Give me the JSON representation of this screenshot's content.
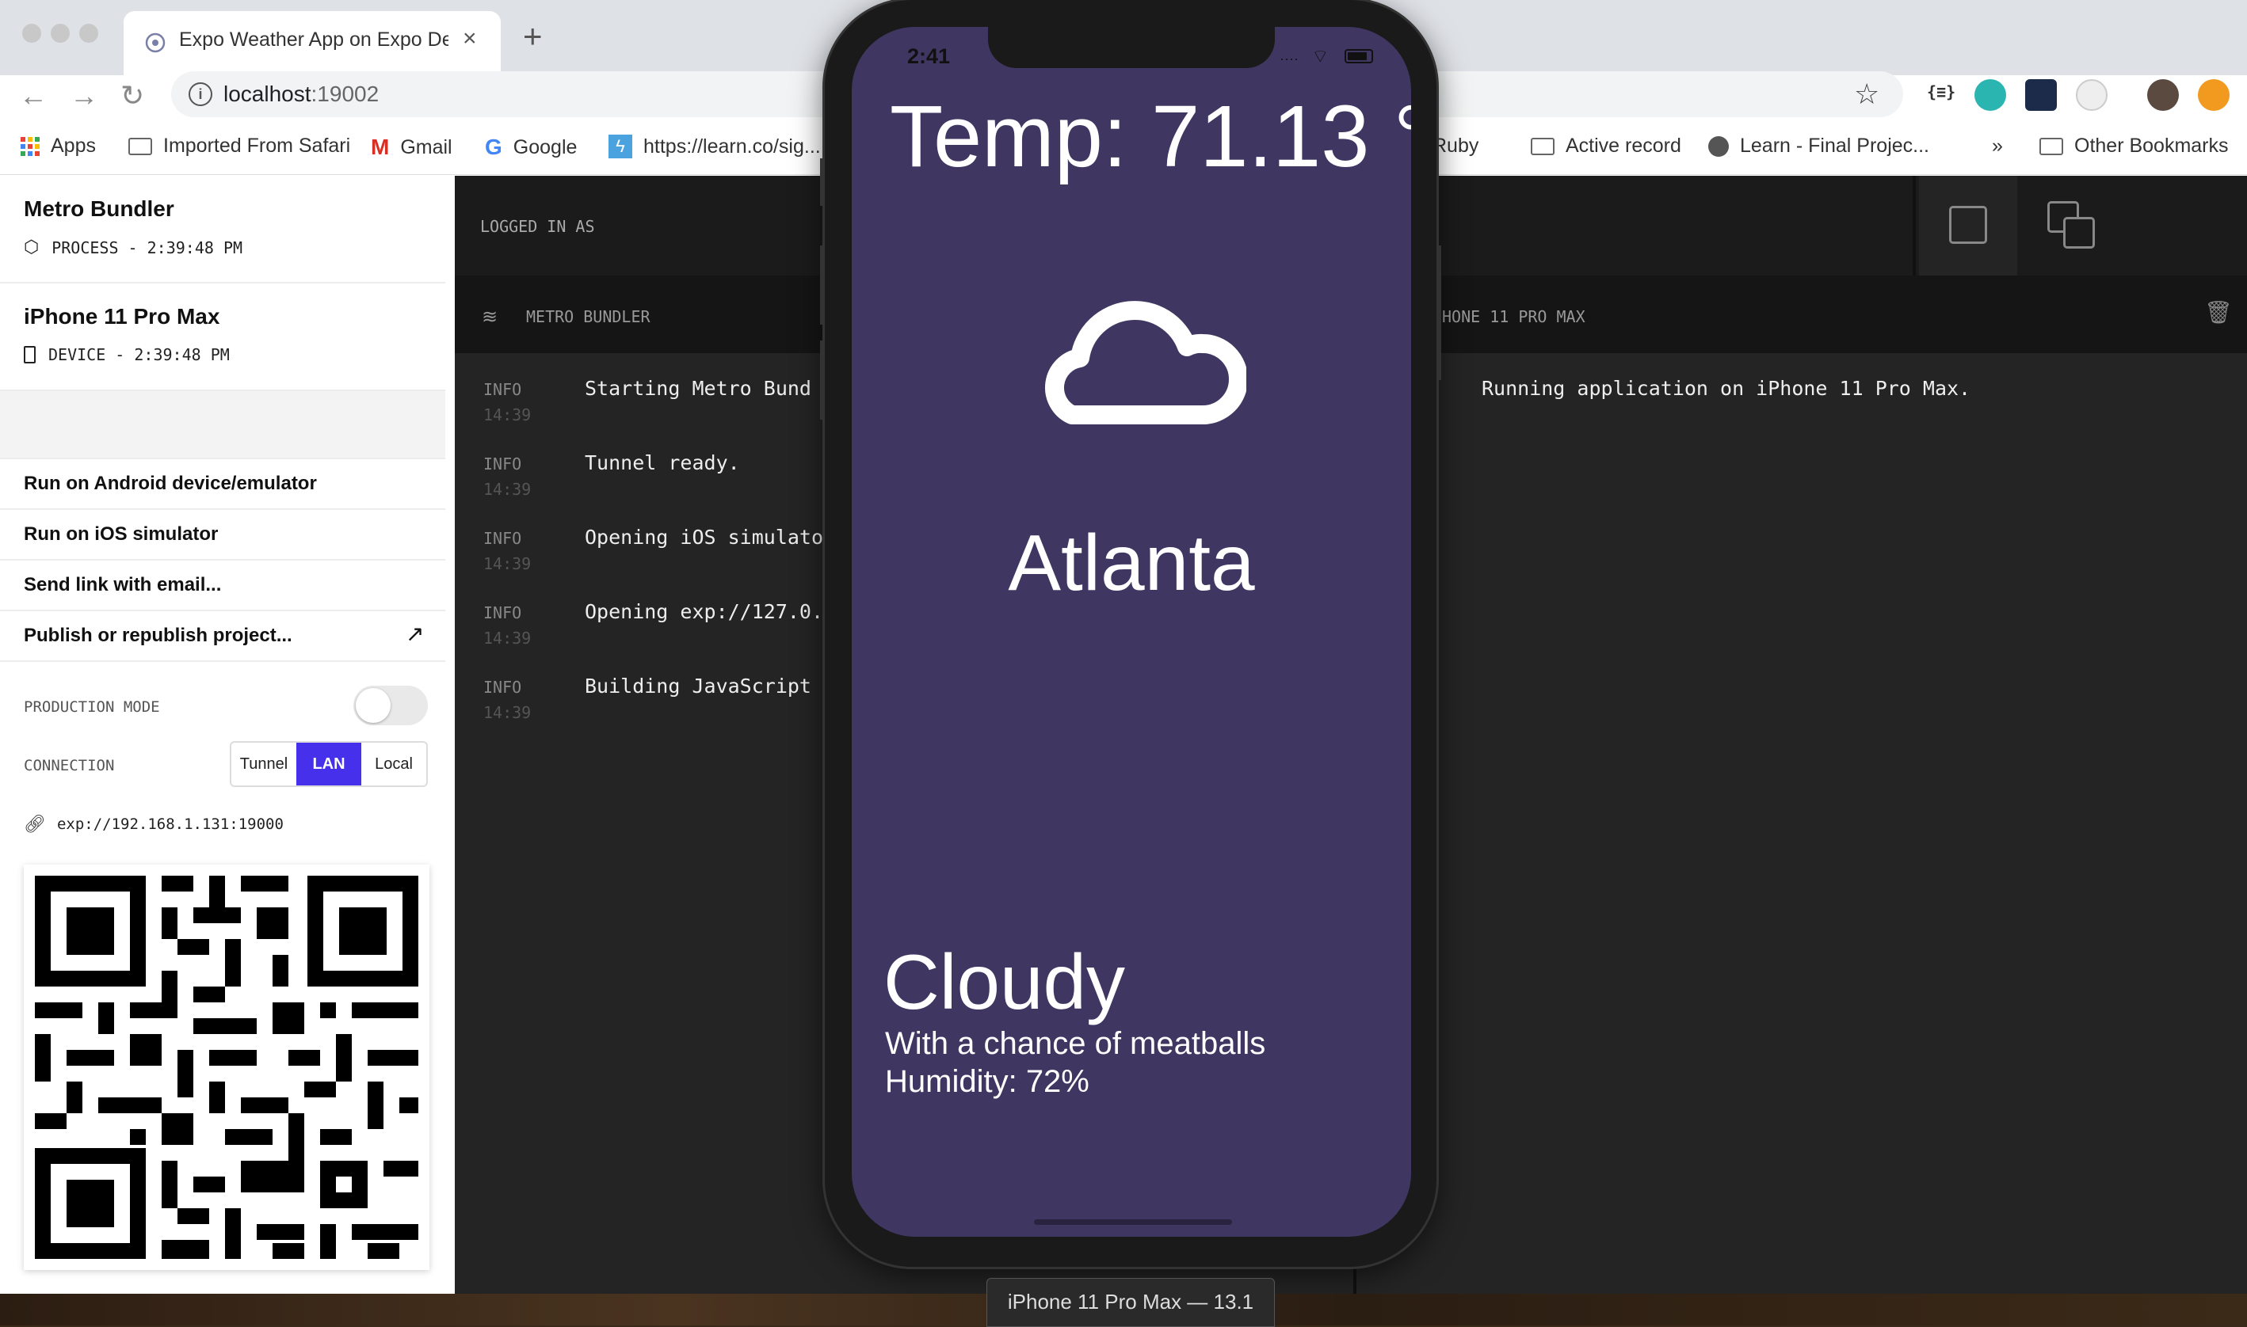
{
  "browser": {
    "tab_title": "Expo Weather App on Expo Developer Tools",
    "new_tab": "+",
    "url_host": "localhost",
    "url_port": ":19002",
    "bookmarks": [
      {
        "label": "Apps"
      },
      {
        "label": "Imported From Safari"
      },
      {
        "label": "Gmail"
      },
      {
        "label": "Google"
      },
      {
        "label": "https://learn.co/sig..."
      },
      {
        "label": "Ruby"
      },
      {
        "label": "Active record"
      },
      {
        "label": "Learn - Final Projec..."
      },
      {
        "label": "»"
      },
      {
        "label": "Other Bookmarks"
      }
    ]
  },
  "sidebar": {
    "process_title": "Metro Bundler",
    "process_sub": "PROCESS - 2:39:48 PM",
    "device_title": "iPhone 11 Pro Max",
    "device_sub": "DEVICE - 2:39:48 PM",
    "menu": [
      {
        "label": "Run on Android device/emulator"
      },
      {
        "label": "Run on iOS simulator"
      },
      {
        "label": "Send link with email..."
      },
      {
        "label": "Publish or republish project..."
      }
    ],
    "production_mode_label": "PRODUCTION MODE",
    "production_mode_on": false,
    "connection_label": "CONNECTION",
    "connection_options": [
      "Tunnel",
      "LAN",
      "Local"
    ],
    "connection_selected": "LAN",
    "exp_url": "exp://192.168.1.131:19000"
  },
  "main": {
    "logged_in_as": "LOGGED IN AS",
    "panel_left_title": "METRO BUNDLER",
    "panel_right_title": "HONE 11 PRO MAX",
    "logs_left": [
      {
        "level": "INFO",
        "time": "14:39",
        "message": "Starting Metro Bund"
      },
      {
        "level": "INFO",
        "time": "14:39",
        "message": "Tunnel ready."
      },
      {
        "level": "INFO",
        "time": "14:39",
        "message": "Opening iOS simulato"
      },
      {
        "level": "INFO",
        "time": "14:39",
        "message": "Opening exp://127.0."
      },
      {
        "level": "INFO",
        "time": "14:39",
        "message": "Building JavaScript"
      }
    ],
    "logs_right": [
      {
        "message": "Running application on iPhone 11 Pro Max."
      }
    ]
  },
  "phone": {
    "clock": "2:41",
    "temp": "Temp: 71.13 °",
    "city": "Atlanta",
    "condition": "Cloudy",
    "description": "With a chance of meatballs",
    "humidity": "Humidity: 72%",
    "background_color": "#3f3761"
  },
  "simulator_label": "iPhone 11 Pro Max — 13.1",
  "colors": {
    "accent": "#4630eb",
    "log_bg": "#242424"
  }
}
